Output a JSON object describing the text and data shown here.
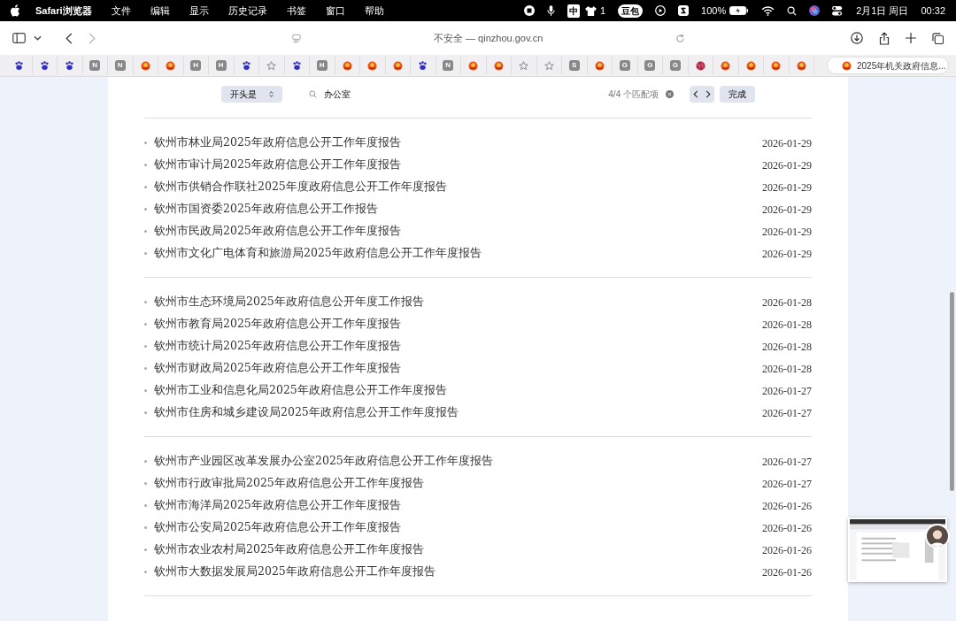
{
  "menu_bar": {
    "app": "Safari浏览器",
    "items": [
      "文件",
      "编辑",
      "显示",
      "历史记录",
      "书签",
      "窗口",
      "帮助"
    ],
    "status": {
      "input_method": "中",
      "notification_count": "1",
      "doubao": "豆包",
      "battery": "100%",
      "date": "2月1日 周日",
      "time": "00:32"
    }
  },
  "toolbar": {
    "address": "不安全 — qinzhou.gov.cn"
  },
  "tabs": [
    {
      "kind": "paw",
      "selected": false
    },
    {
      "kind": "paw",
      "selected": false
    },
    {
      "kind": "paw",
      "selected": false
    },
    {
      "kind": "letter",
      "letter": "N",
      "selected": false
    },
    {
      "kind": "letter",
      "letter": "N",
      "selected": false
    },
    {
      "kind": "emblem",
      "selected": false
    },
    {
      "kind": "emblem",
      "selected": false
    },
    {
      "kind": "letter",
      "letter": "H",
      "selected": false
    },
    {
      "kind": "letter",
      "letter": "H",
      "selected": false
    },
    {
      "kind": "paw",
      "selected": false
    },
    {
      "kind": "star",
      "selected": false
    },
    {
      "kind": "paw",
      "selected": false
    },
    {
      "kind": "letter",
      "letter": "H",
      "selected": false
    },
    {
      "kind": "emblem",
      "selected": false
    },
    {
      "kind": "emblem",
      "selected": false
    },
    {
      "kind": "emblem",
      "selected": false
    },
    {
      "kind": "paw",
      "selected": false
    },
    {
      "kind": "letter",
      "letter": "N",
      "selected": false
    },
    {
      "kind": "emblem",
      "selected": false
    },
    {
      "kind": "emblem",
      "selected": false
    },
    {
      "kind": "star",
      "selected": false
    },
    {
      "kind": "star",
      "selected": false
    },
    {
      "kind": "letter",
      "letter": "S",
      "selected": false
    },
    {
      "kind": "emblem",
      "selected": false
    },
    {
      "kind": "letter",
      "letter": "G",
      "selected": false
    },
    {
      "kind": "letter",
      "letter": "G",
      "selected": false
    },
    {
      "kind": "letter",
      "letter": "G",
      "selected": false
    },
    {
      "kind": "globe",
      "selected": false
    },
    {
      "kind": "emblem",
      "selected": false
    },
    {
      "kind": "emblem",
      "selected": false
    },
    {
      "kind": "emblem",
      "selected": false
    },
    {
      "kind": "emblem",
      "selected": false
    },
    {
      "kind": "emblem",
      "selected": true,
      "title": "2025年机关政府信息..."
    }
  ],
  "find_bar": {
    "mode": "开头是",
    "query": "办公室",
    "matches": "4/4 个匹配项",
    "done": "完成"
  },
  "sections": [
    {
      "rows": [
        {
          "title": "钦州市林业局2025年政府信息公开工作年度报告",
          "date": "2026-01-29"
        },
        {
          "title": "钦州市审计局2025年政府信息公开工作年度报告",
          "date": "2026-01-29"
        },
        {
          "title": "钦州市供销合作联社2025年度政府信息公开工作年度报告",
          "date": "2026-01-29"
        },
        {
          "title": "钦州市国资委2025年政府信息公开工作报告",
          "date": "2026-01-29"
        },
        {
          "title": "钦州市民政局2025年政府信息公开工作年度报告",
          "date": "2026-01-29"
        },
        {
          "title": "钦州市文化广电体育和旅游局2025年政府信息公开工作年度报告",
          "date": "2026-01-29"
        }
      ]
    },
    {
      "rows": [
        {
          "title": "钦州市生态环境局2025年政府信息公开年度工作报告",
          "date": "2026-01-28"
        },
        {
          "title": "钦州市教育局2025年政府信息公开工作年度报告",
          "date": "2026-01-28"
        },
        {
          "title": "钦州市统计局2025年政府信息公开工作年度报告",
          "date": "2026-01-28"
        },
        {
          "title": "钦州市财政局2025年政府信息公开工作年度报告",
          "date": "2026-01-28"
        },
        {
          "title": "钦州市工业和信息化局2025年政府信息公开工作年度报告",
          "date": "2026-01-27"
        },
        {
          "title": "钦州市住房和城乡建设局2025年政府信息公开工作年度报告",
          "date": "2026-01-27"
        }
      ]
    },
    {
      "rows": [
        {
          "title": "钦州市产业园区改革发展办公室2025年政府信息公开工作年度报告",
          "date": "2026-01-27"
        },
        {
          "title": "钦州市行政审批局2025年政府信息公开工作年度报告",
          "date": "2026-01-27"
        },
        {
          "title": "钦州市海洋局2025年政府信息公开工作年度报告",
          "date": "2026-01-26"
        },
        {
          "title": "钦州市公安局2025年政府信息公开工作年度报告",
          "date": "2026-01-26"
        },
        {
          "title": "钦州市农业农村局2025年政府信息公开工作年度报告",
          "date": "2026-01-26"
        },
        {
          "title": "钦州市大数据发展局2025年政府信息公开工作年度报告",
          "date": "2026-01-26"
        }
      ]
    }
  ]
}
